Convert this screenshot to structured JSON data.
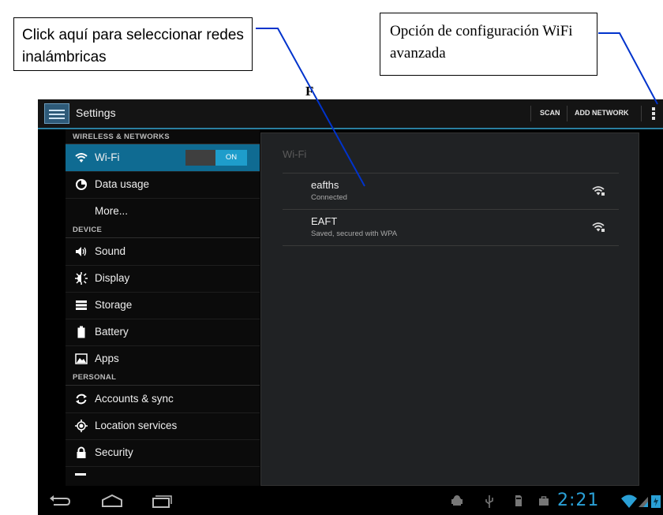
{
  "callouts": {
    "left_text": "Click aquí para seleccionar redes inalámbricas",
    "right_text": "Opción de configuración WiFi avanzada",
    "stray_letter": "F"
  },
  "actionbar": {
    "title": "Settings",
    "scan_label": "SCAN",
    "add_network_label": "ADD NETWORK"
  },
  "sidebar": {
    "sections": {
      "wireless": "WIRELESS & NETWORKS",
      "device": "DEVICE",
      "personal": "PERSONAL"
    },
    "items": [
      {
        "label": "Wi-Fi",
        "icon": "wifi-icon",
        "selected": true
      },
      {
        "label": "Data usage",
        "icon": "data-usage-icon"
      },
      {
        "label": "More...",
        "icon": ""
      },
      {
        "label": "Sound",
        "icon": "sound-icon"
      },
      {
        "label": "Display",
        "icon": "display-icon"
      },
      {
        "label": "Storage",
        "icon": "storage-icon"
      },
      {
        "label": "Battery",
        "icon": "battery-icon"
      },
      {
        "label": "Apps",
        "icon": "apps-icon"
      },
      {
        "label": "Accounts & sync",
        "icon": "sync-icon"
      },
      {
        "label": "Location services",
        "icon": "location-icon"
      },
      {
        "label": "Security",
        "icon": "lock-icon"
      }
    ],
    "wifi_toggle": "ON"
  },
  "content": {
    "title": "Wi-Fi",
    "networks": [
      {
        "name": "eafths",
        "status": "Connected"
      },
      {
        "name": "EAFT",
        "status": "Saved, secured with WPA"
      }
    ]
  },
  "statusbar": {
    "time": "2:21"
  },
  "colors": {
    "accent": "#0f6b92",
    "toggle_on": "#1e9dcb",
    "clock": "#2aa0d6",
    "leader_line": "#0033cc"
  }
}
